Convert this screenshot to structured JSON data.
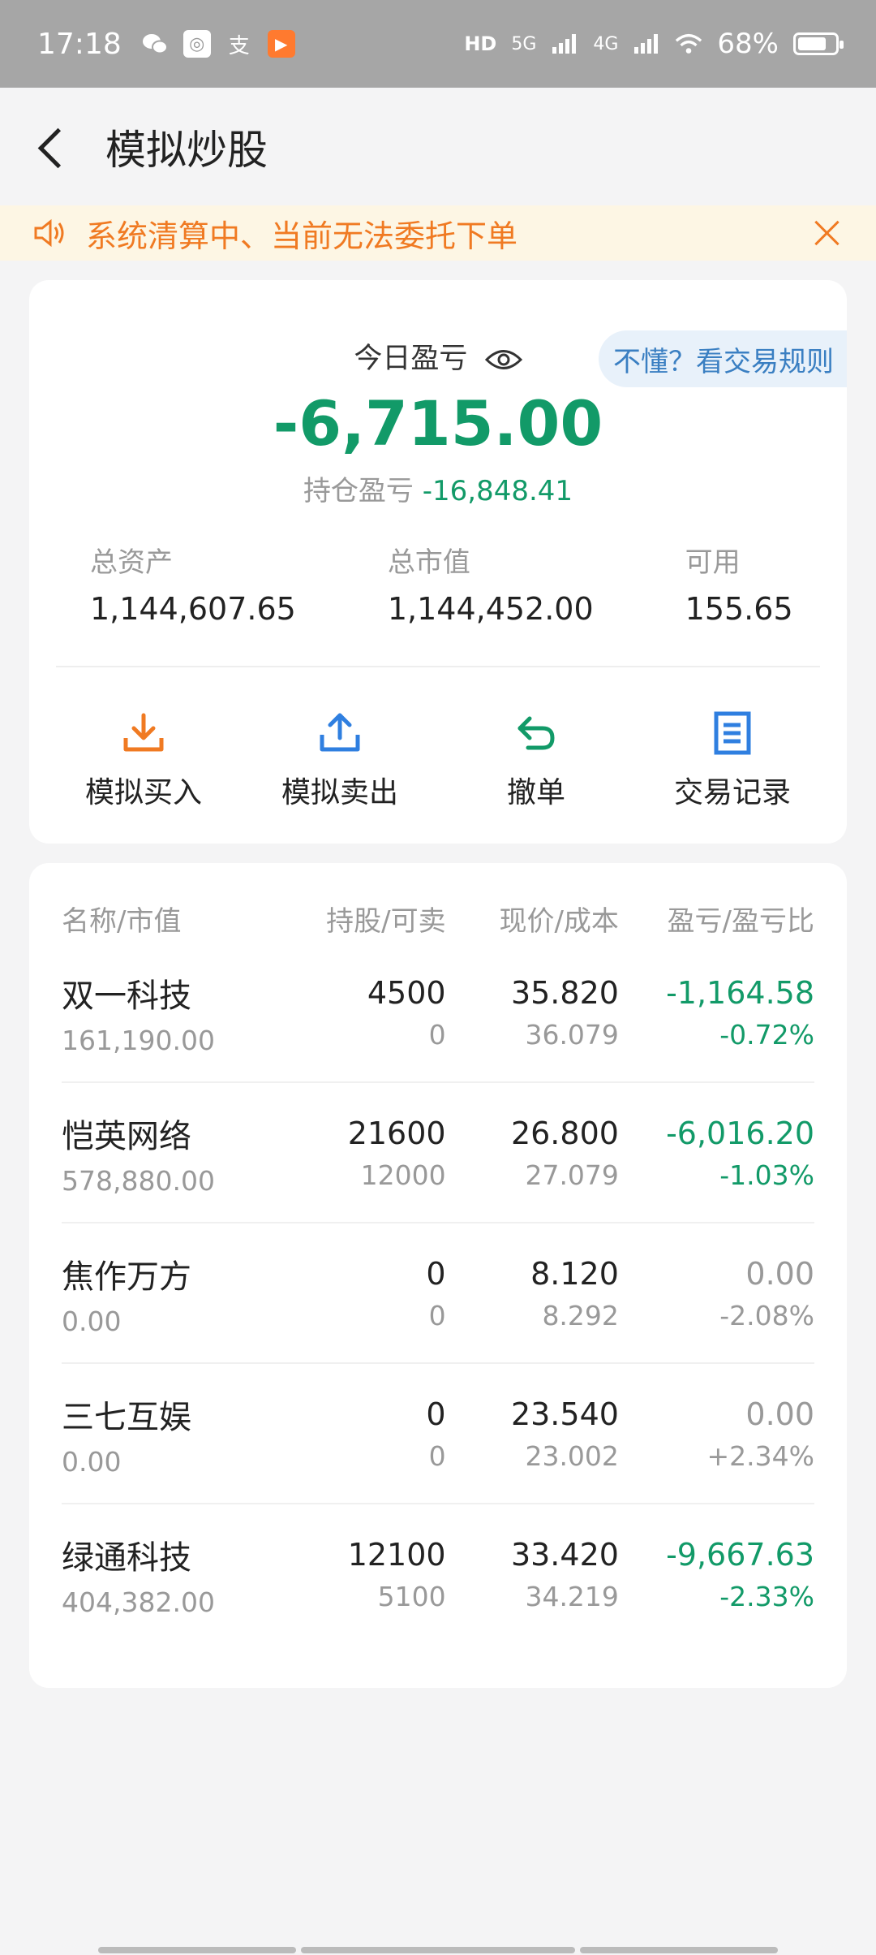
{
  "status_bar": {
    "time": "17:18",
    "battery": "68%",
    "network_labels": [
      "HD",
      "5G",
      "4G"
    ],
    "app_icons": [
      "wechat-icon",
      "app-icon",
      "alipay-icon",
      "video-app-icon"
    ]
  },
  "nav": {
    "title": "模拟炒股"
  },
  "notice": {
    "text": "系统清算中、当前无法委托下单"
  },
  "summary": {
    "rules_link": "不懂？看交易规则",
    "today_label": "今日盈亏",
    "today_value": "-6,715.00",
    "hold_label": "持仓盈亏",
    "hold_value": "-16,848.41",
    "assets": [
      {
        "label": "总资产",
        "value": "1,144,607.65"
      },
      {
        "label": "总市值",
        "value": "1,144,452.00"
      },
      {
        "label": "可用",
        "value": "155.65"
      }
    ],
    "actions": [
      {
        "label": "模拟买入",
        "icon": "buy-icon",
        "color": "#f07a22"
      },
      {
        "label": "模拟卖出",
        "icon": "sell-icon",
        "color": "#2f7fe0"
      },
      {
        "label": "撤单",
        "icon": "undo-icon",
        "color": "#129a68"
      },
      {
        "label": "交易记录",
        "icon": "record-icon",
        "color": "#2f7fe0"
      }
    ]
  },
  "holdings": {
    "headers": [
      "名称/市值",
      "持股/可卖",
      "现价/成本",
      "盈亏/盈亏比"
    ],
    "rows": [
      {
        "name": "双一科技",
        "market_value": "161,190.00",
        "shares": "4500",
        "sellable": "0",
        "price": "35.820",
        "cost": "36.079",
        "pnl": "-1,164.58",
        "pnl_ratio": "-0.72%",
        "pnl_color": "green",
        "ratio_color": "green"
      },
      {
        "name": "恺英网络",
        "market_value": "578,880.00",
        "shares": "21600",
        "sellable": "12000",
        "price": "26.800",
        "cost": "27.079",
        "pnl": "-6,016.20",
        "pnl_ratio": "-1.03%",
        "pnl_color": "green",
        "ratio_color": "green"
      },
      {
        "name": "焦作万方",
        "market_value": "0.00",
        "shares": "0",
        "sellable": "0",
        "price": "8.120",
        "cost": "8.292",
        "pnl": "0.00",
        "pnl_ratio": "-2.08%",
        "pnl_color": "gray",
        "ratio_color": "gray"
      },
      {
        "name": "三七互娱",
        "market_value": "0.00",
        "shares": "0",
        "sellable": "0",
        "price": "23.540",
        "cost": "23.002",
        "pnl": "0.00",
        "pnl_ratio": "+2.34%",
        "pnl_color": "gray",
        "ratio_color": "gray"
      },
      {
        "name": "绿通科技",
        "market_value": "404,382.00",
        "shares": "12100",
        "sellable": "5100",
        "price": "33.420",
        "cost": "34.219",
        "pnl": "-9,667.63",
        "pnl_ratio": "-2.33%",
        "pnl_color": "green",
        "ratio_color": "green"
      }
    ]
  }
}
